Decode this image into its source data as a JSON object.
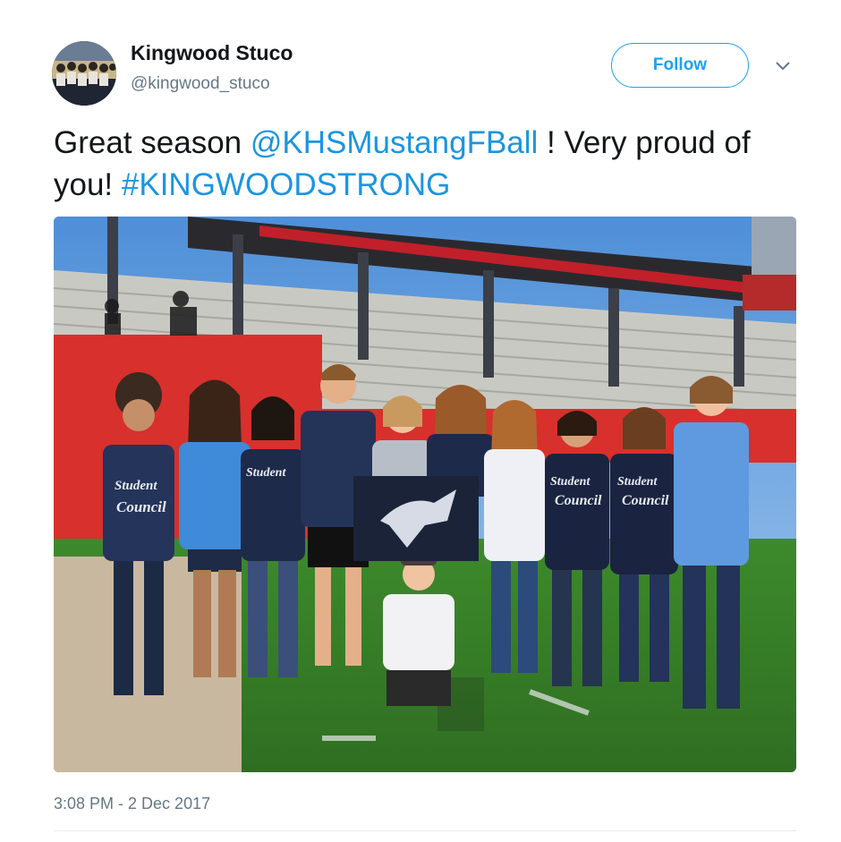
{
  "tweet": {
    "display_name": "Kingwood Stuco",
    "handle": "@kingwood_stuco",
    "follow_label": "Follow",
    "text_parts": [
      "Great season ",
      "@KHSMustangFBall",
      " !  Very proud of you!  ",
      "#KINGWOODSTRONG"
    ],
    "timestamp": "3:08 PM - 2 Dec 2017"
  },
  "photo": {
    "shirt_text_student": "Student",
    "shirt_text_council": "Council"
  },
  "colors": {
    "accent": "#1da1f2",
    "link": "#1b95e0",
    "muted": "#657786"
  },
  "icons": {
    "caret": "chevron-down-icon"
  }
}
